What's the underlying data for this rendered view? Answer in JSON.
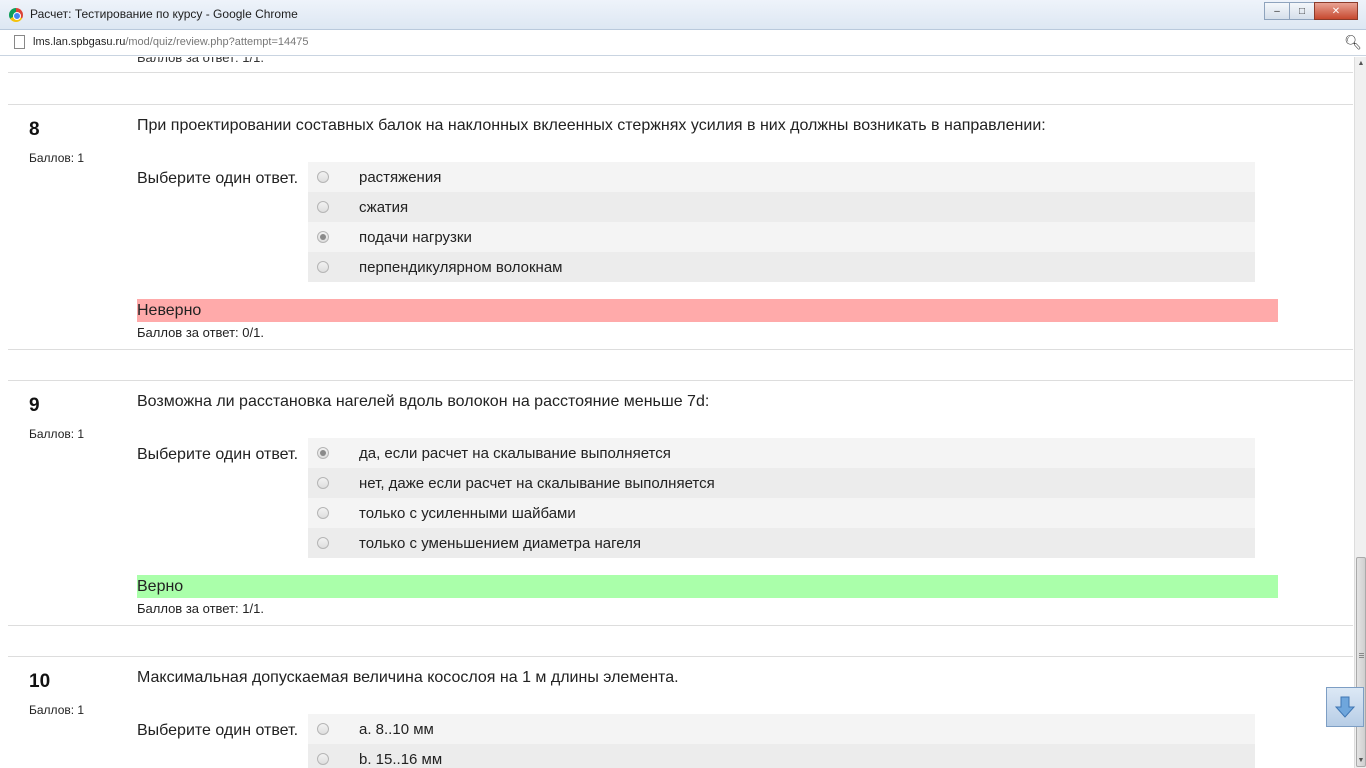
{
  "window": {
    "title": "Расчет: Тестирование по курсу - Google Chrome",
    "url_host": "lms.lan.spbgasu.ru",
    "url_path": "/mod/quiz/review.php?attempt=14475"
  },
  "previous_tail": "Баллов за ответ: 1/1.",
  "questions": [
    {
      "number": "8",
      "grade": "Баллов: 1",
      "text": "При проектировании составных балок на наклонных вклеенных стержнях усилия в них должны возникать в направлении:",
      "prompt": "Выберите один ответ.",
      "answers": [
        "растяжения",
        "сжатия",
        "подачи нагрузки",
        "перпендикулярном волокнам"
      ],
      "selected_index": 2,
      "feedback": "Неверно",
      "feedback_state": "wrong",
      "score": "Баллов за ответ: 0/1."
    },
    {
      "number": "9",
      "grade": "Баллов: 1",
      "text": "Возможна ли расстановка нагелей вдоль волокон на расстояние меньше 7d:",
      "prompt": "Выберите один ответ.",
      "answers": [
        "да, если расчет на скалывание выполняется",
        "нет, даже если расчет на скалывание выполняется",
        "только с усиленными шайбами",
        "только с уменьшением диаметра нагеля"
      ],
      "selected_index": 0,
      "feedback": "Верно",
      "feedback_state": "right",
      "score": "Баллов за ответ: 1/1."
    },
    {
      "number": "10",
      "grade": "Баллов: 1",
      "text": "Максимальная допускаемая величина косослоя на 1 м длины элемента.",
      "prompt": "Выберите один ответ.",
      "answers": [
        "a. 8..10 мм",
        "b. 15..16 мм"
      ],
      "selected_index": -1
    }
  ],
  "colors": {
    "wrong_bg": "#ffaaaa",
    "right_bg": "#aaffaa",
    "answer_odd": "#f4f4f4",
    "answer_even": "#ececec"
  },
  "icons": {
    "favicon": "chrome-logo-icon",
    "page": "page-icon",
    "zoom": "zoom-icon",
    "float": "arrow-down-icon"
  }
}
